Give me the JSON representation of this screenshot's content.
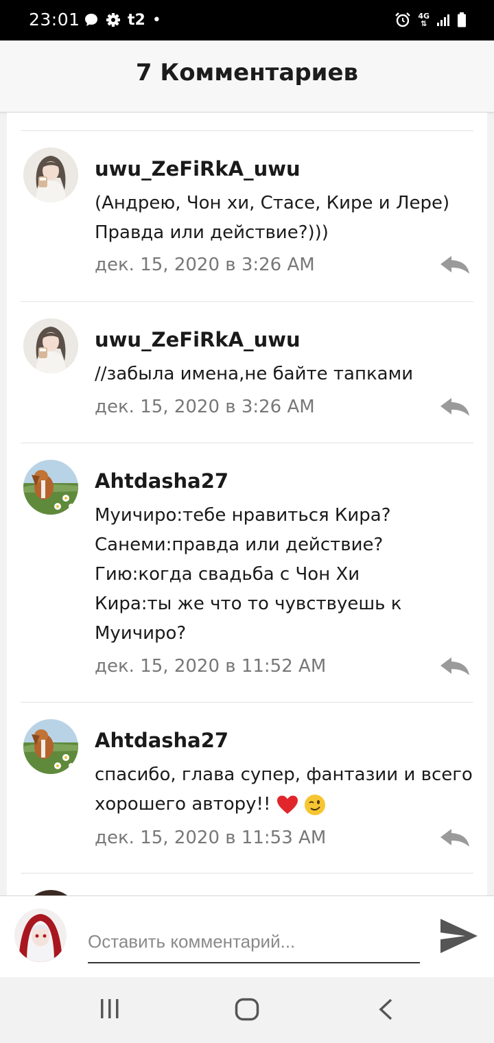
{
  "status_bar": {
    "time": "23:01",
    "carrier": "t2",
    "dot": "•",
    "network": "4G"
  },
  "header": {
    "title": "7 Комментариев"
  },
  "comments": [
    {
      "username": "uwu_ZeFiRkA_uwu",
      "text_lines": [
        "(Андрею, Чон хи, Стасе, Кире и Лере)",
        "Правда или действие?)))"
      ],
      "date": "дек. 15, 2020 в 3:26 AM",
      "avatar_icon": "anime-girl-avatar"
    },
    {
      "username": "uwu_ZeFiRkA_uwu",
      "text_lines": [
        "//забыла имена,не байте тапками"
      ],
      "date": "дек. 15, 2020 в 3:26 AM",
      "avatar_icon": "anime-girl-avatar"
    },
    {
      "username": "Ahtdasha27",
      "text_lines": [
        "Муичиро:тебе нравиться Кира?",
        "Санеми:правда или действие?",
        "Гию:когда свадьба с Чон Хи",
        "Кира:ты же что то чувствуешь к",
        "Муичиро?"
      ],
      "date": "дек. 15, 2020 в 11:52 AM",
      "avatar_icon": "dog-photo-avatar"
    },
    {
      "username": "Ahtdasha27",
      "text_lines": [
        "спасибо, глава супер, фантазии и всего",
        "хорошего автору!!"
      ],
      "date": "дек. 15, 2020 в 11:53 AM",
      "avatar_icon": "dog-photo-avatar",
      "emojis": [
        "red-heart-emoji",
        "winking-face-emoji"
      ]
    }
  ],
  "composer": {
    "placeholder": "Оставить комментарий..."
  },
  "colors": {
    "status_bar": "#000000",
    "header_bg": "#f7f7f7",
    "text": "#1a1a1a",
    "date_text": "#777777",
    "reply_icon": "#9a9a9a",
    "send_icon": "#555555"
  }
}
